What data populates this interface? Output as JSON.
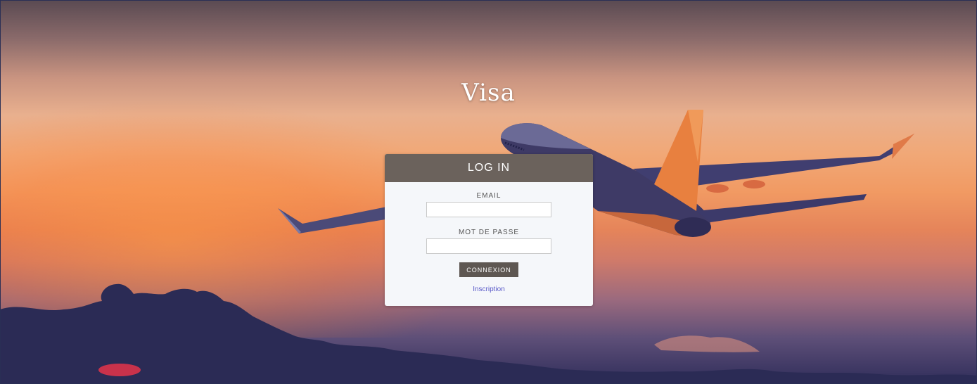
{
  "app": {
    "title": "Visa"
  },
  "login": {
    "header": "LOG IN",
    "email_label": "EMAIL",
    "email_value": "",
    "password_label": "MOT DE PASSE",
    "password_value": "",
    "submit_label": "CONNEXION",
    "register_link": "Inscription"
  },
  "colors": {
    "header_bg": "#6b625c",
    "button_bg": "#5e5752",
    "link": "#5a5ac8",
    "card_bg": "#f5f7fa"
  },
  "background": {
    "icon": "airplane-sunset-photo"
  }
}
